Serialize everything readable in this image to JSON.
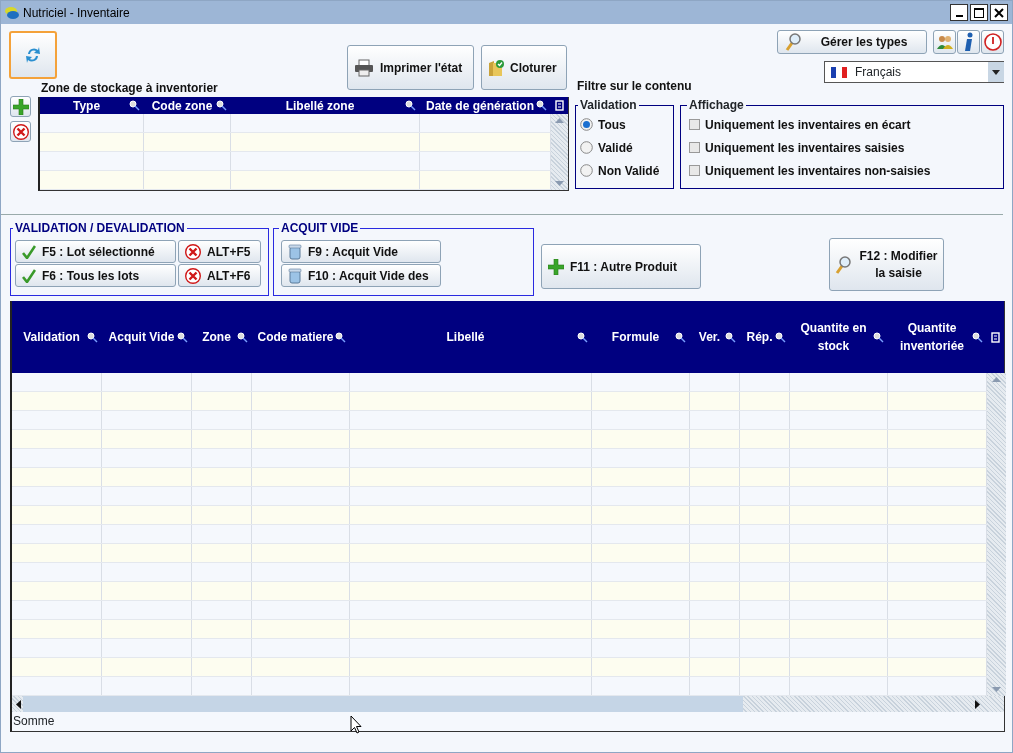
{
  "window": {
    "title": "Nutriciel - Inventaire"
  },
  "refresh_button": {
    "focused": true
  },
  "toolbar": [
    {
      "label": "Imprimer l'état",
      "kind": "print"
    },
    {
      "label": "Cloturer",
      "kind": "close"
    }
  ],
  "manage_types_button": "Gérer les types",
  "language": "Français",
  "zone_grid": {
    "title": "Zone de stockage à inventorier",
    "columns": [
      "Type",
      "Code zone",
      "Libellé zone",
      "Date de génération"
    ]
  },
  "filter": {
    "title": "Filtre sur le contenu",
    "validation": {
      "title": "Validation",
      "options": [
        {
          "label": "Tous",
          "selected": true
        },
        {
          "label": "Validé",
          "selected": false
        },
        {
          "label": "Non Validé",
          "selected": false
        }
      ]
    },
    "display": {
      "title": "Affichage",
      "options": [
        {
          "label": "Uniquement les inventaires en écart",
          "checked": false
        },
        {
          "label": "Uniquement les inventaires saisies",
          "checked": false
        },
        {
          "label": "Uniquement les inventaires non-saisies",
          "checked": false
        }
      ]
    }
  },
  "validation_group": {
    "title": "VALIDATION / DEVALIDATION",
    "buttons": [
      {
        "label": "F5 : Lot sélectionné",
        "kind": "validate"
      },
      {
        "label": "ALT+F5",
        "kind": "cancel"
      },
      {
        "label": "F6 : Tous les lots",
        "kind": "validate"
      },
      {
        "label": "ALT+F6",
        "kind": "cancel"
      }
    ]
  },
  "acquit_group": {
    "title": "ACQUIT VIDE",
    "buttons": [
      {
        "label": "F9 : Acquit Vide",
        "kind": "empty"
      },
      {
        "label": "F10 : Acquit Vide des",
        "kind": "empty"
      }
    ]
  },
  "actions": [
    {
      "label": "F11 : Autre Produit",
      "kind": "add"
    },
    {
      "label": "F12 : Modifier la saisie",
      "kind": "edit"
    }
  ],
  "main_grid": {
    "columns": [
      "Validation",
      "Acquit Vide",
      "Zone",
      "Code matiere",
      "Libellé",
      "Formule",
      "Ver.",
      "Rép.",
      "Quantite en stock",
      "Quantite inventoriée"
    ],
    "footer": "Somme"
  }
}
